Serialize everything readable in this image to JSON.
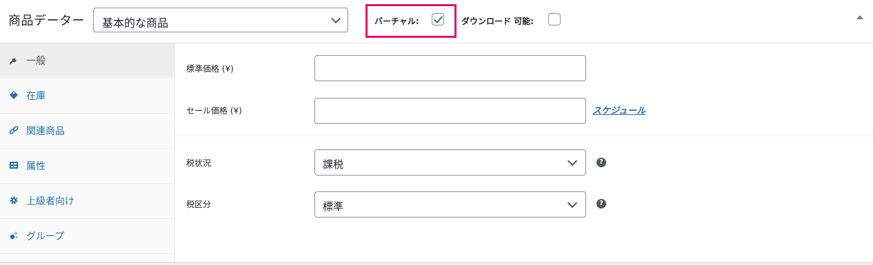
{
  "header": {
    "title": "商品データー",
    "product_type": {
      "selected": "基本的な商品"
    },
    "virtual": {
      "label": "バーチャル:",
      "checked": true
    },
    "downloadable": {
      "label": "ダウンロード 可能:",
      "checked": false
    }
  },
  "sidebar": {
    "items": [
      {
        "label": "一般",
        "icon": "wrench-icon",
        "active": true
      },
      {
        "label": "在庫",
        "icon": "tag-icon",
        "active": false
      },
      {
        "label": "関連商品",
        "icon": "link-icon",
        "active": false
      },
      {
        "label": "属性",
        "icon": "list-icon",
        "active": false
      },
      {
        "label": "上級者向け",
        "icon": "gear-icon",
        "active": false
      },
      {
        "label": "グループ",
        "icon": "groups-icon",
        "active": false
      }
    ]
  },
  "general": {
    "regular_price": {
      "label": "標準価格 (¥)",
      "value": ""
    },
    "sale_price": {
      "label": "セール価格 (¥)",
      "value": "",
      "schedule_link": "スケジュール"
    },
    "tax_status": {
      "label": "税状況",
      "selected": "課税"
    },
    "tax_class": {
      "label": "税区分",
      "selected": "標準"
    }
  },
  "colors": {
    "accent": "#2271b1",
    "highlight": "#e2116b"
  }
}
